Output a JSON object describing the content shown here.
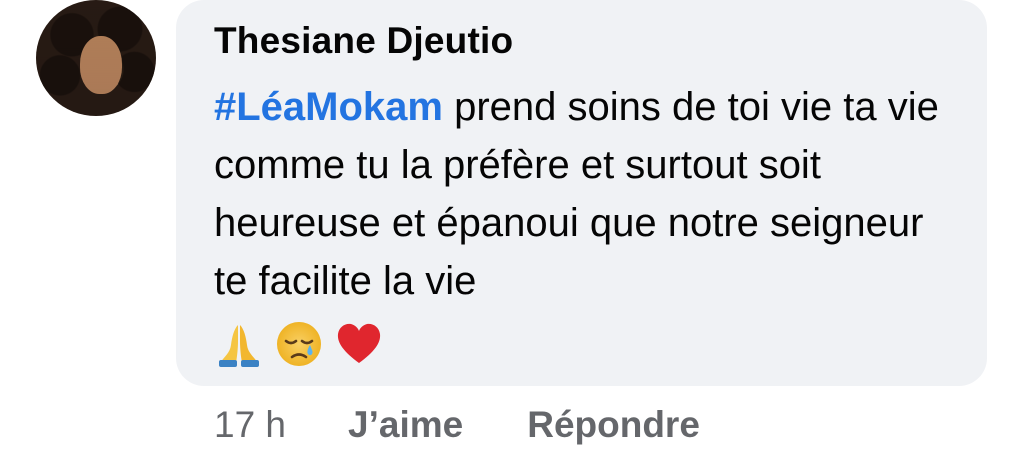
{
  "comment": {
    "author": "Thesiane Djeutio",
    "mention": "#LéaMokam",
    "text": " prend soins de toi vie ta vie comme tu la préfère et surtout soit heureuse et épanoui que notre seigneur te facilite la vie",
    "emojis": [
      "folded-hands-icon",
      "crying-face-icon",
      "red-heart-icon"
    ],
    "timestamp": "17 h",
    "like_label": "J’aime",
    "reply_label": "Répondre"
  },
  "colors": {
    "bubble": "#f0f2f5",
    "mention": "#2374e1",
    "meta": "#65676b",
    "text": "#050505"
  }
}
